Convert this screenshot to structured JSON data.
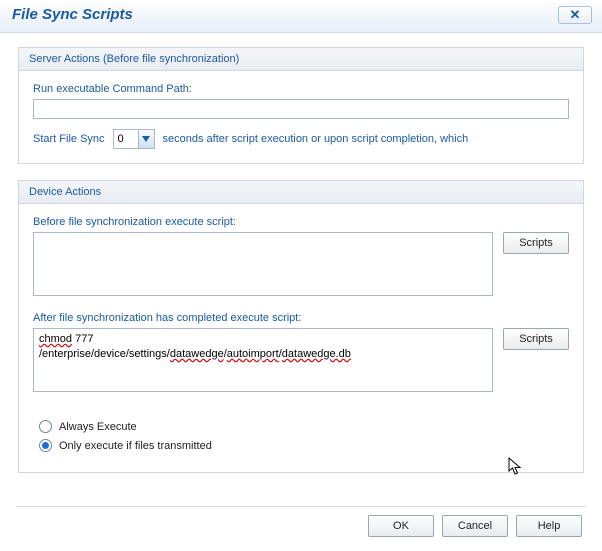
{
  "title": "File Sync Scripts",
  "server_actions": {
    "header": "Server Actions (Before file synchronization)",
    "command_path_label": "Run executable Command Path:",
    "command_path_value": "",
    "delay_leading": "Start File Sync",
    "delay_value": "0",
    "delay_trailing": "seconds after script execution or upon script completion, which"
  },
  "device_actions": {
    "header": "Device Actions",
    "before_label": "Before file synchronization execute script:",
    "before_value": "",
    "after_label": "After file synchronization has completed execute script:",
    "after_line1_pre": "   ",
    "after_line1_cmd": "chmod",
    "after_line1_rest": " 777",
    "after_line2_p1": "/enterprise/device/settings/",
    "after_line2_u1": "datawedge",
    "after_line2_p2": "/",
    "after_line2_u2": "autoimport",
    "after_line2_p3": "/",
    "after_line2_u3": "datawedge.db",
    "scripts_button": "Scripts",
    "radio_always": "Always Execute",
    "radio_only": "Only execute if files transmitted",
    "selected": "only"
  },
  "buttons": {
    "ok": "OK",
    "cancel": "Cancel",
    "help": "Help"
  }
}
